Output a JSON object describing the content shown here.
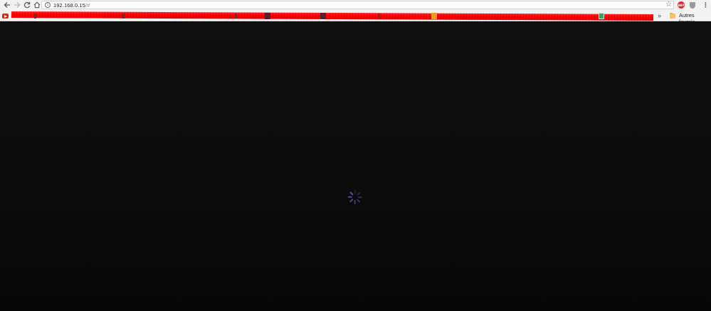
{
  "browser": {
    "url_host": "192.168.0.15",
    "url_path": "/#",
    "nav": {
      "back_icon": "arrow-left-icon",
      "forward_icon": "arrow-right-icon",
      "reload_icon": "reload-icon",
      "home_icon": "home-icon"
    },
    "extensions": {
      "abp_label": "ABP",
      "menu_icon": "kebab-menu-icon"
    },
    "bookmarks": {
      "overflow_label": "»",
      "other_folder_label": "Autres favoris"
    }
  },
  "page": {
    "state": "loading",
    "spinner_icon": "loading-spinner-icon"
  },
  "colors": {
    "redaction": "#ff0000",
    "page_background": "#0b0b0b",
    "spinner": "#5b5bb8"
  }
}
